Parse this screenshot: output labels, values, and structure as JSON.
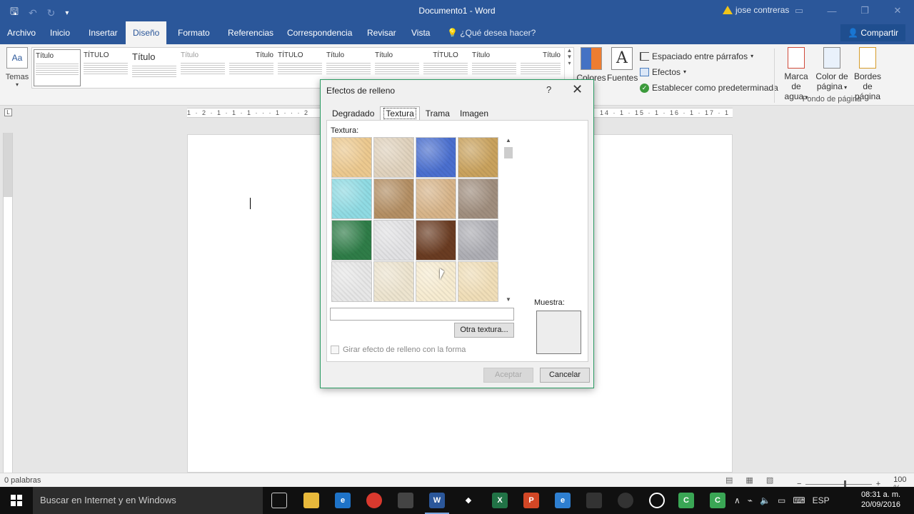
{
  "window": {
    "title": "Documento1 - Word",
    "user": "jose contreras"
  },
  "tabs": [
    "Archivo",
    "Inicio",
    "Insertar",
    "Diseño",
    "Formato",
    "Referencias",
    "Correspondencia",
    "Revisar",
    "Vista"
  ],
  "active_tab": "Diseño",
  "tell_me": "¿Qué desea hacer?",
  "share_label": "Compartir",
  "ribbon": {
    "temas": "Temas",
    "gallery_titles": [
      "Título",
      "TÍTULO",
      "Título",
      "Título",
      "Título",
      "TÍTULO",
      "Título",
      "Título",
      "TÍTULO",
      "Título",
      "Título"
    ],
    "colores": "Colores",
    "fuentes": "Fuentes",
    "espaciado": "Espaciado entre párrafos",
    "efectos": "Efectos",
    "predeterminada": "Establecer como predeterminada",
    "marca_agua_1": "Marca de",
    "marca_agua_2": "agua",
    "color_pagina_1": "Color de",
    "color_pagina_2": "página",
    "bordes_1": "Bordes",
    "bordes_2": "de página",
    "fondo_group": "Fondo de página"
  },
  "ruler_left": "1 · 2 · 1 · 1 · 1 · · · 1 · · · 2",
  "ruler_right": "14 · 1 · 15 · 1 · 16 · 1 · 17 · 1 · 18 · 1 · 19",
  "dialog": {
    "title": "Efectos de relleno",
    "help": "?",
    "close": "✕",
    "tabs": [
      "Degradado",
      "Textura",
      "Trama",
      "Imagen"
    ],
    "active_tab": "Textura",
    "textura_label": "Textura:",
    "texture_name_value": "",
    "otra_textura": "Otra textura...",
    "girar_label": "Girar efecto de relleno con la forma",
    "girar_checked": false,
    "muestra_label": "Muestra:",
    "aceptar": "Aceptar",
    "cancelar": "Cancelar",
    "textures": [
      {
        "name": "papiro",
        "color": "#ecc98f"
      },
      {
        "name": "lienzo",
        "color": "#e0d2bd"
      },
      {
        "name": "tela-vaquera",
        "color": "#4a6fcf"
      },
      {
        "name": "arpillera",
        "color": "#c9a25d"
      },
      {
        "name": "gotas-agua",
        "color": "#8fdbe3"
      },
      {
        "name": "bolsa-papel",
        "color": "#b48f64"
      },
      {
        "name": "fosil",
        "color": "#d7b489"
      },
      {
        "name": "arena",
        "color": "#a08e7e"
      },
      {
        "name": "marmol-verde",
        "color": "#2f7d48"
      },
      {
        "name": "marmol-blanco",
        "color": "#e2e2e4"
      },
      {
        "name": "marmol-marron",
        "color": "#6a3c22"
      },
      {
        "name": "granito",
        "color": "#aeaeb4"
      },
      {
        "name": "papel-periodico",
        "color": "#e7e7e7"
      },
      {
        "name": "papel-reciclado",
        "color": "#ede4cf"
      },
      {
        "name": "pergamino",
        "color": "#f7ecd1"
      },
      {
        "name": "papel-ramo",
        "color": "#f0deb8"
      }
    ]
  },
  "status": {
    "words": "0 palabras",
    "zoom": "100 %"
  },
  "taskbar": {
    "search_placeholder": "Buscar en Internet y en Windows",
    "lang": "ESP",
    "time": "08:31 a. m.",
    "date": "20/09/2016"
  }
}
